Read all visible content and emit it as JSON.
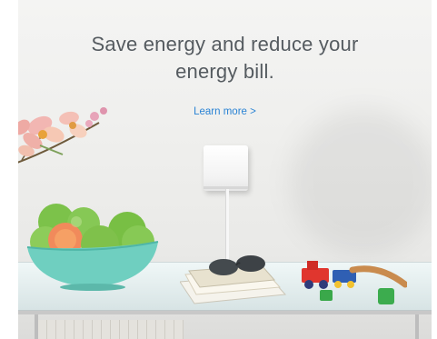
{
  "hero": {
    "headline_line1": "Save energy and reduce your",
    "headline_line2": "energy bill.",
    "link_label": "Learn more >"
  },
  "colors": {
    "headline": "#555b60",
    "link": "#2a83d4"
  },
  "icons": [
    "orchid-flower-image",
    "apple-bowl-image",
    "ac-controller-device-image",
    "sunglasses-image",
    "toy-train-image"
  ]
}
